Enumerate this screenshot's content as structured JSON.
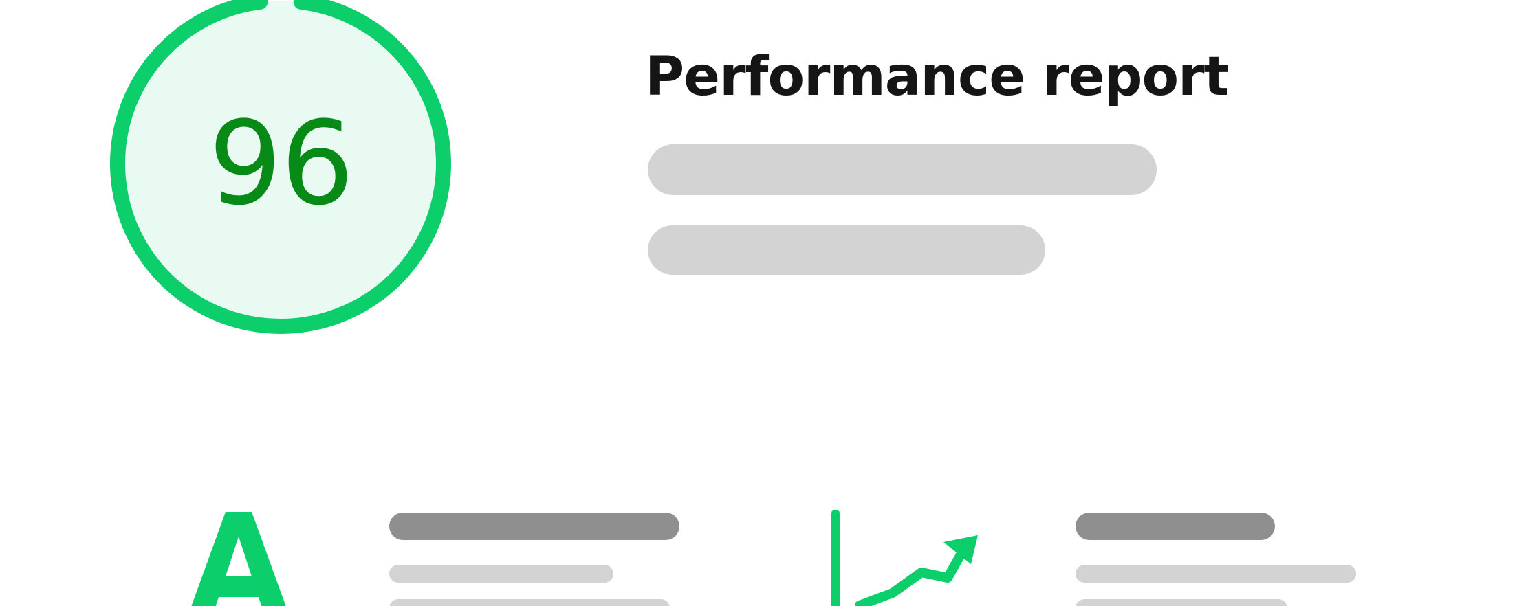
{
  "score": {
    "value": "96",
    "fraction": 0.96,
    "ring_color": "#0cce6b",
    "fill_color": "#e8faf1",
    "text_color": "#088a16"
  },
  "report": {
    "title": "Performance report"
  },
  "icons": {
    "left": "letter-a-icon",
    "right": "trend-up-chart-icon",
    "accent_color": "#0cce6b"
  },
  "colors": {
    "skeleton_light": "#d3d3d3",
    "skeleton_dark": "#8f8f8f",
    "title_text": "#151515"
  }
}
